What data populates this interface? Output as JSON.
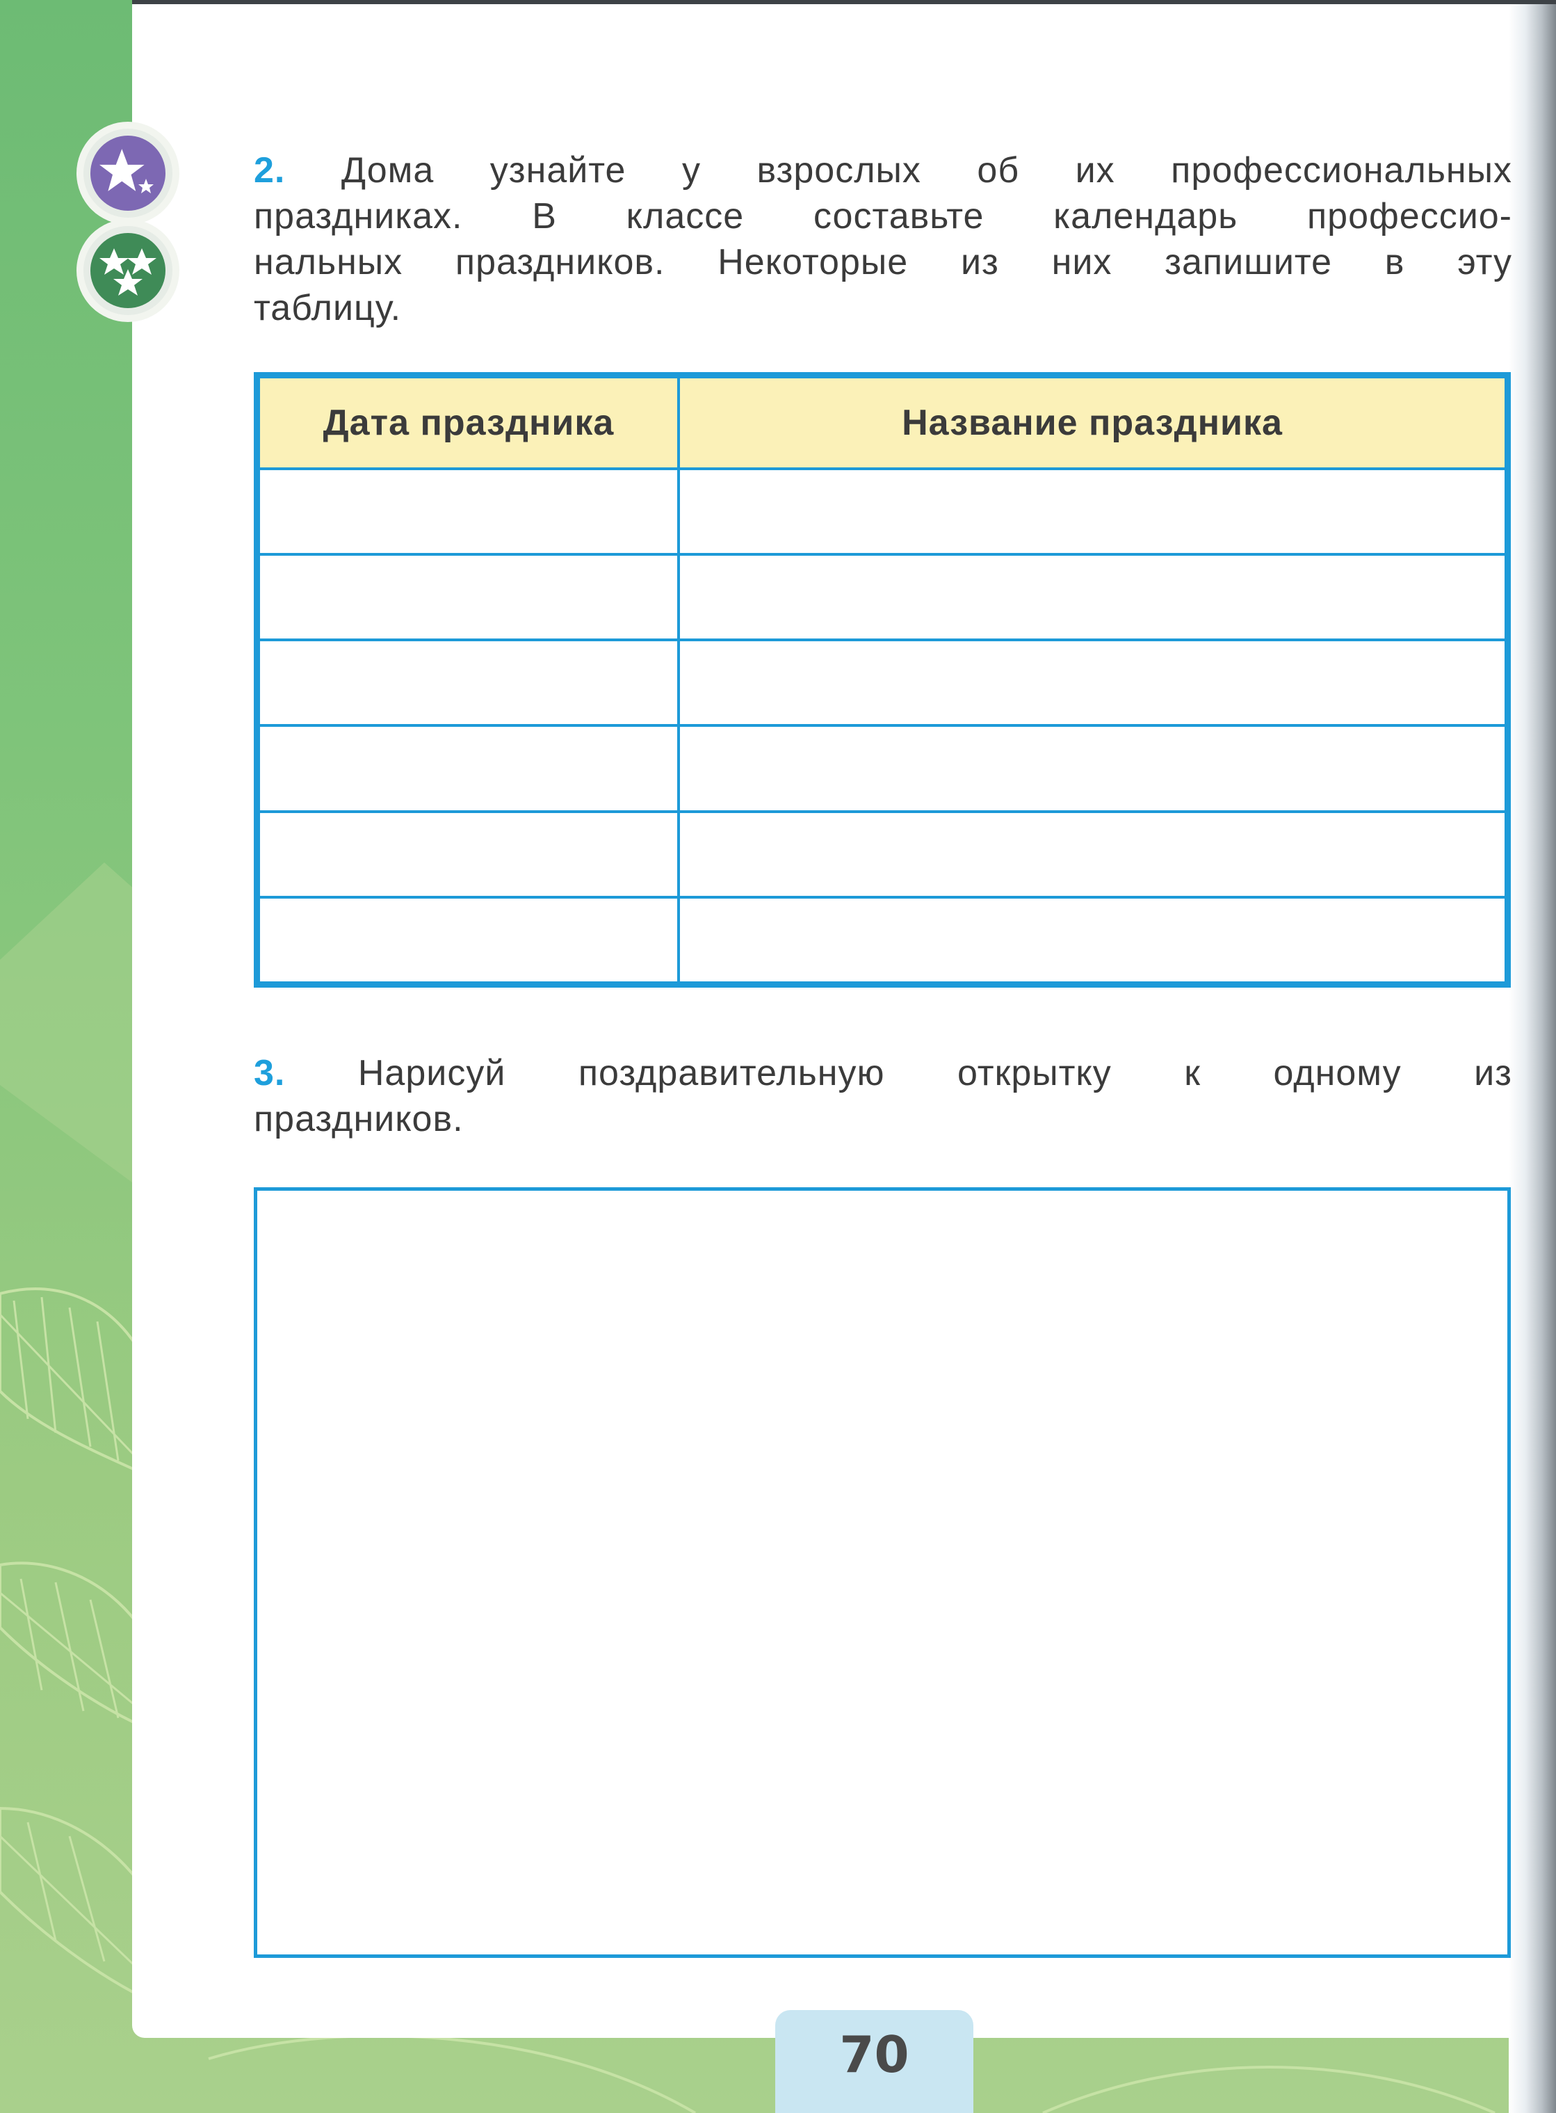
{
  "task2": {
    "number": "2.",
    "lines": [
      "Дома узнайте у взрослых об их профессиональных",
      "праздниках. В классе составьте календарь профессио-",
      "нальных праздников. Некоторые из них запишите в эту",
      "таблицу."
    ]
  },
  "table": {
    "headers": [
      "Дата праздника",
      "Название праздника"
    ],
    "rows": [
      [
        "",
        ""
      ],
      [
        "",
        ""
      ],
      [
        "",
        ""
      ],
      [
        "",
        ""
      ],
      [
        "",
        ""
      ],
      [
        "",
        ""
      ]
    ]
  },
  "task3": {
    "number": "3.",
    "lines": [
      "Нарисуй поздравительную открытку к одному из",
      "праздников."
    ]
  },
  "page_number": "70",
  "badges": [
    {
      "icon": "purple-star-badge-icon",
      "color": "#7d68b3"
    },
    {
      "icon": "green-three-stars-badge-icon",
      "color": "#3f8b57"
    }
  ],
  "colors": {
    "accent_blue": "#1d9ad8",
    "header_fill": "#fbf1b8",
    "margin_green": "#7fc47a"
  }
}
